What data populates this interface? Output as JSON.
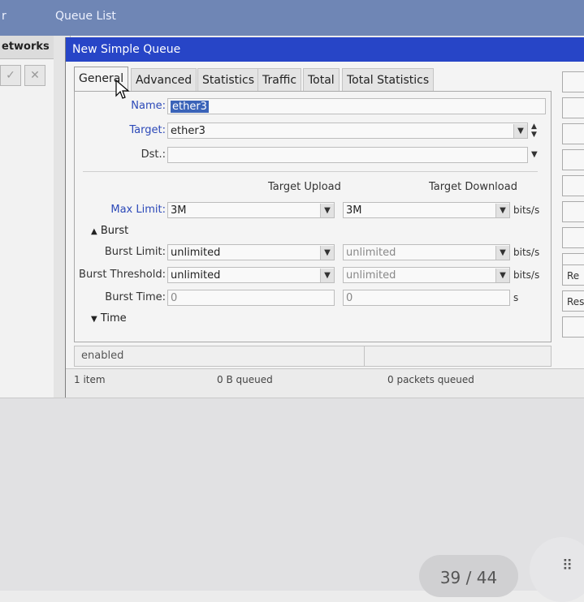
{
  "background": {
    "window_title": "Queue List",
    "cut_title": "r",
    "left_panel_header": "etworks",
    "left_buttons": [
      "check-icon",
      "cross-icon"
    ]
  },
  "dialog": {
    "title": "New Simple Queue",
    "tabs": [
      {
        "label": "General",
        "active": true
      },
      {
        "label": "Advanced",
        "active": false
      },
      {
        "label": "Statistics",
        "active": false
      },
      {
        "label": "Traffic",
        "active": false
      },
      {
        "label": "Total",
        "active": false
      },
      {
        "label": "Total Statistics",
        "active": false
      }
    ],
    "name_label": "Name:",
    "name_value": "ether3",
    "target_label": "Target:",
    "target_value": "ether3",
    "dst_label": "Dst.:",
    "dst_value": "",
    "col_upload": "Target Upload",
    "col_download": "Target Download",
    "max_limit_label": "Max Limit:",
    "max_limit_upload": "3M",
    "max_limit_download": "3M",
    "unit_bits": "bits/s",
    "unit_s": "s",
    "burst_section": "Burst",
    "burst_limit_label": "Burst Limit:",
    "burst_limit_upload": "unlimited",
    "burst_limit_download": "unlimited",
    "burst_threshold_label": "Burst Threshold:",
    "burst_threshold_upload": "unlimited",
    "burst_threshold_download": "unlimited",
    "burst_time_label": "Burst Time:",
    "burst_time_upload": "0",
    "burst_time_download": "0",
    "time_section": "Time",
    "status_text": "enabled",
    "side_buttons": [
      "",
      "",
      "",
      "",
      "",
      "",
      "",
      "",
      "Re",
      "Rese",
      ""
    ]
  },
  "footer": {
    "items": "1 item",
    "bytes_queued": "0 B queued",
    "packets_queued": "0 packets queued"
  },
  "overlay": {
    "page_indicator": "39 / 44"
  }
}
